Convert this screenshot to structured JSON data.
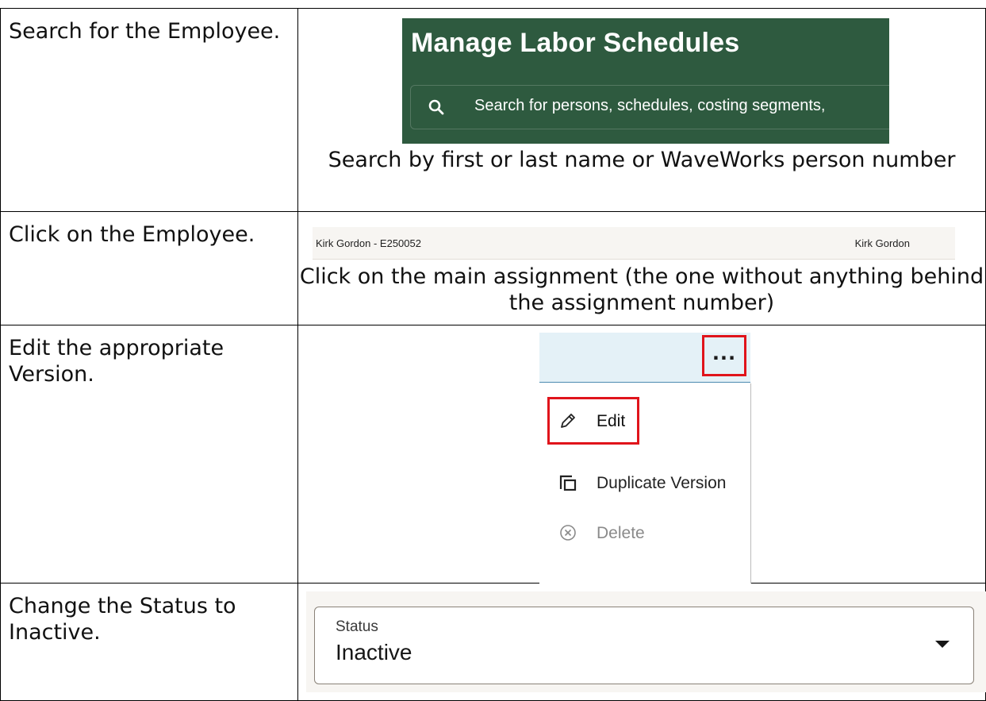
{
  "steps": [
    {
      "instruction": "Search for the Employee.",
      "caption": "Search by first or last name or WaveWorks person number"
    },
    {
      "instruction": "Click on the Employee.",
      "caption": "Click on the main assignment (the one without anything behind the assignment number)"
    },
    {
      "instruction": "Edit the appropriate Version."
    },
    {
      "instruction": "Change the Status to Inactive."
    }
  ],
  "search_panel": {
    "title": "Manage Labor Schedules",
    "placeholder": "Search for persons, schedules, costing segments,",
    "icon": "search-icon",
    "background": "#2e5a3f"
  },
  "employee_row": {
    "left_text": "Kirk Gordon - E250052",
    "right_text": "Kirk Gordon"
  },
  "version_menu": {
    "more_label": "...",
    "items": [
      {
        "label": "Edit",
        "icon": "pencil-icon",
        "highlighted": true
      },
      {
        "label": "Duplicate Version",
        "icon": "duplicate-icon"
      },
      {
        "label": "Delete",
        "icon": "delete-icon",
        "disabled": true
      }
    ],
    "highlight_color": "#e0141b"
  },
  "status_field": {
    "label": "Status",
    "value": "Inactive"
  }
}
